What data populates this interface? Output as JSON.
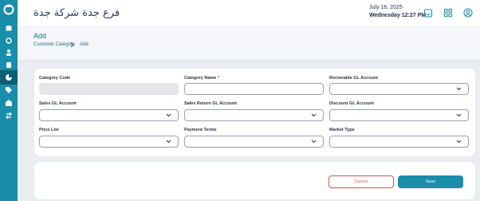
{
  "header": {
    "brand": "فرع جدة شركة جدة",
    "date": "July 16, 2025",
    "datetime": "Wednesday 12:27 PM"
  },
  "page": {
    "title": "Add",
    "breadcrumb": [
      "Customer Category",
      "Add"
    ]
  },
  "form": {
    "category_code_label": "Category Code",
    "category_name_label": "Category Name",
    "required_mark": "*",
    "receivable_gl_label": "Recievable GL Account",
    "sales_gl_label": "Sales GL Account",
    "sales_return_gl_label": "Sales Return GL Account",
    "discount_gl_label": "Discount GL Account",
    "price_list_label": "Price List",
    "payment_terms_label": "Payment Terms",
    "market_type_label": "Market Type"
  },
  "actions": {
    "cancel": "Cancel",
    "save": "Save"
  },
  "colors": {
    "primary": "#1a8dab",
    "danger": "#d9534f"
  },
  "icons": [
    "logo-icon",
    "calendar-icon",
    "grid-icon",
    "user-icon",
    "chevron-down-icon",
    "chevron-right-icon"
  ]
}
